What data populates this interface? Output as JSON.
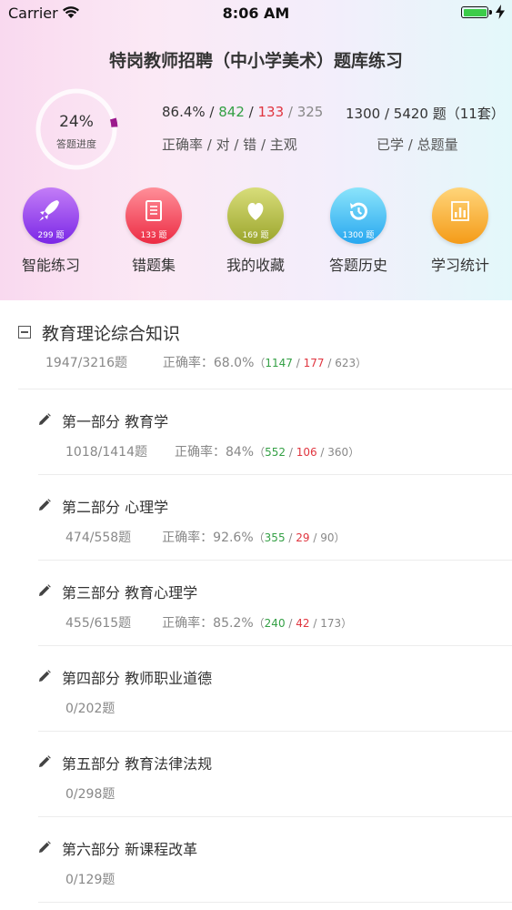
{
  "status_bar": {
    "carrier": "Carrier",
    "time": "8:06 AM"
  },
  "page_title": "特岗教师招聘（中小学美术）题库练习",
  "progress_ring": {
    "percent_text": "24%",
    "label": "答题进度",
    "fraction": 0.24
  },
  "accuracy": {
    "rate": "86.4%",
    "correct": "842",
    "wrong": "133",
    "subjective": "325",
    "label": "正确率 / 对 / 错 / 主观"
  },
  "learned": {
    "done": "1300",
    "total": "5420",
    "unit": "题",
    "sets": "（11套）",
    "label": "已学 / 总题量"
  },
  "actions": [
    {
      "label": "智能练习",
      "badge": "299 题",
      "icon": "rocket-icon",
      "color_top": "#c37df7",
      "color_bottom": "#7a27e6"
    },
    {
      "label": "错题集",
      "badge": "133 题",
      "icon": "document-icon",
      "color_top": "#ff8f99",
      "color_bottom": "#ec2b43"
    },
    {
      "label": "我的收藏",
      "badge": "169 题",
      "icon": "heart-icon",
      "color_top": "#d8dd7a",
      "color_bottom": "#9ba52c"
    },
    {
      "label": "答题历史",
      "badge": "1300 题",
      "icon": "history-icon",
      "color_top": "#8be4fb",
      "color_bottom": "#27a7ef"
    },
    {
      "label": "学习统计",
      "badge": "",
      "icon": "bar-chart-icon",
      "color_top": "#ffd57a",
      "color_bottom": "#f49b18"
    }
  ],
  "section": {
    "title": "教育理论综合知识",
    "progress": "1947/3216题",
    "accuracy_label": "正确率：",
    "accuracy": "68.0%",
    "open": "（",
    "correct": "1147",
    "wrong": "177",
    "subjective": "623",
    "close": "）"
  },
  "chapters": [
    {
      "title": "第一部分 教育学",
      "progress": "1018/1414题",
      "accuracy_label": "正确率：",
      "accuracy": "84%",
      "open": "（",
      "correct": "552",
      "wrong": "106",
      "subjective": "360",
      "close": "）",
      "has_stats": true
    },
    {
      "title": "第二部分 心理学",
      "progress": "474/558题",
      "accuracy_label": "正确率：",
      "accuracy": "92.6%",
      "open": "（",
      "correct": "355",
      "wrong": "29",
      "subjective": "90",
      "close": "）",
      "has_stats": true
    },
    {
      "title": "第三部分 教育心理学",
      "progress": "455/615题",
      "accuracy_label": "正确率：",
      "accuracy": "85.2%",
      "open": "（",
      "correct": "240",
      "wrong": "42",
      "subjective": "173",
      "close": "）",
      "has_stats": true
    },
    {
      "title": "第四部分 教师职业道德",
      "progress": "0/202题",
      "has_stats": false
    },
    {
      "title": "第五部分 教育法律法规",
      "progress": "0/298题",
      "has_stats": false
    },
    {
      "title": "第六部分 新课程改革",
      "progress": "0/129题",
      "has_stats": false
    }
  ]
}
